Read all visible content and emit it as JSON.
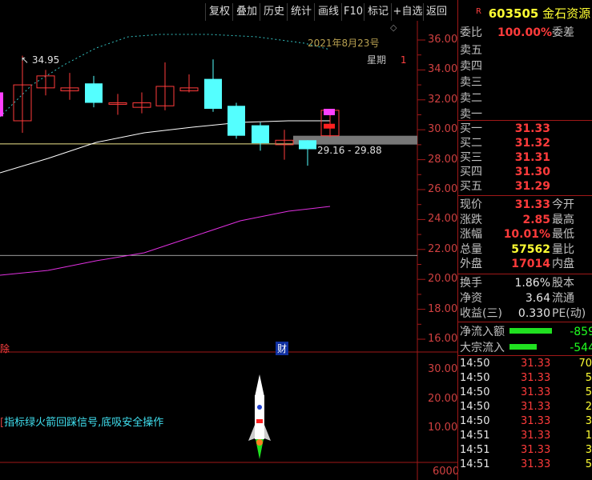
{
  "toolbar": {
    "buttons": [
      "复权",
      "叠加",
      "历史",
      "统计",
      "画线",
      "F10",
      "标记",
      "+自选",
      "返回"
    ]
  },
  "stock": {
    "badge": "R",
    "code": "603505",
    "name": "金石资源"
  },
  "order_book": {
    "ratio_label": "委比",
    "ratio_value": "100.00%",
    "diff_label": "委差",
    "asks": [
      {
        "label": "卖五",
        "price": ""
      },
      {
        "label": "卖四",
        "price": ""
      },
      {
        "label": "卖三",
        "price": ""
      },
      {
        "label": "卖二",
        "price": ""
      },
      {
        "label": "卖一",
        "price": ""
      }
    ],
    "bids": [
      {
        "label": "买一",
        "price": "31.33"
      },
      {
        "label": "买二",
        "price": "31.32"
      },
      {
        "label": "买三",
        "price": "31.31"
      },
      {
        "label": "买四",
        "price": "31.30"
      },
      {
        "label": "买五",
        "price": "31.29"
      }
    ]
  },
  "quote": [
    {
      "label": "现价",
      "value": "31.33",
      "right": "今开",
      "color": "red"
    },
    {
      "label": "涨跌",
      "value": "2.85",
      "right": "最高",
      "color": "red"
    },
    {
      "label": "涨幅",
      "value": "10.01%",
      "right": "最低",
      "color": "red"
    },
    {
      "label": "总量",
      "value": "57562",
      "right": "量比",
      "color": "yellow"
    },
    {
      "label": "外盘",
      "value": "17014",
      "right": "内盘",
      "color": "red"
    }
  ],
  "fundamentals": [
    {
      "label": "换手",
      "value": "1.86%",
      "right": "股本"
    },
    {
      "label": "净资",
      "value": "3.64",
      "right": "流通"
    },
    {
      "label": "收益(三)",
      "value": "0.330",
      "right": "PE(动)"
    }
  ],
  "flows": [
    {
      "label": "净流入额",
      "value": "-859",
      "bar": 0.85
    },
    {
      "label": "大宗流入",
      "value": "-544",
      "bar": 0.55
    }
  ],
  "trades": [
    {
      "time": "14:50",
      "price": "31.33",
      "vol": "70"
    },
    {
      "time": "14:50",
      "price": "31.33",
      "vol": "5"
    },
    {
      "time": "14:50",
      "price": "31.33",
      "vol": "5"
    },
    {
      "time": "14:50",
      "price": "31.33",
      "vol": "2"
    },
    {
      "time": "14:50",
      "price": "31.33",
      "vol": "3"
    },
    {
      "time": "14:51",
      "price": "31.33",
      "vol": "1"
    },
    {
      "time": "14:51",
      "price": "31.33",
      "vol": "3"
    },
    {
      "time": "14:51",
      "price": "31.33",
      "vol": "5"
    }
  ],
  "main_chart": {
    "date_label": "2021年8月23号",
    "weekday_label": "星期",
    "weekday_value": "1",
    "high_marker": "34.95",
    "range_label": "29.16 - 29.88",
    "y_ticks": [
      "36.00",
      "34.00",
      "32.00",
      "30.00",
      "28.00",
      "26.00",
      "24.00",
      "22.00",
      "20.00",
      "18.00",
      "16.00"
    ],
    "left_marker": "除",
    "finance_marker": "财",
    "candles": [
      {
        "o": 30.6,
        "c": 33.0,
        "h": 34.95,
        "l": 29.8,
        "up": false
      },
      {
        "o": 32.8,
        "c": 33.6,
        "h": 34.0,
        "l": 32.3,
        "up": false
      },
      {
        "o": 32.6,
        "c": 32.8,
        "h": 33.8,
        "l": 32.0,
        "up": false
      },
      {
        "o": 33.1,
        "c": 31.8,
        "h": 33.6,
        "l": 31.5,
        "up": true
      },
      {
        "o": 31.7,
        "c": 31.8,
        "h": 32.4,
        "l": 31.0,
        "up": false
      },
      {
        "o": 31.5,
        "c": 31.8,
        "h": 32.5,
        "l": 31.1,
        "up": false
      },
      {
        "o": 31.6,
        "c": 32.9,
        "h": 34.5,
        "l": 31.3,
        "up": false
      },
      {
        "o": 32.6,
        "c": 32.8,
        "h": 33.7,
        "l": 32.5,
        "up": false
      },
      {
        "o": 33.4,
        "c": 31.4,
        "h": 34.7,
        "l": 31.2,
        "up": true
      },
      {
        "o": 31.6,
        "c": 29.6,
        "h": 31.8,
        "l": 29.4,
        "up": true
      },
      {
        "o": 30.3,
        "c": 29.1,
        "h": 30.5,
        "l": 28.6,
        "up": true
      },
      {
        "o": 29.0,
        "c": 29.3,
        "h": 30.0,
        "l": 28.0,
        "up": false
      },
      {
        "o": 29.3,
        "c": 28.7,
        "h": 29.3,
        "l": 27.6,
        "up": true
      },
      {
        "o": 29.6,
        "c": 31.3,
        "h": 31.4,
        "l": 29.5,
        "up": false
      }
    ]
  },
  "sub_chart": {
    "signal_text": "指标绿火箭回踩信号,底吸安全操作",
    "y_ticks": [
      "30.00",
      "20.00",
      "10.00"
    ],
    "bottom_tick": "6000"
  },
  "colors": {
    "up": "#ff3b3b",
    "down": "#54ffff",
    "grid": "#a01818",
    "ma_white": "#ffffff",
    "ma_magenta": "#e030e0",
    "ma_cyan": "#33c0c0",
    "hline": "#f0e68c"
  }
}
